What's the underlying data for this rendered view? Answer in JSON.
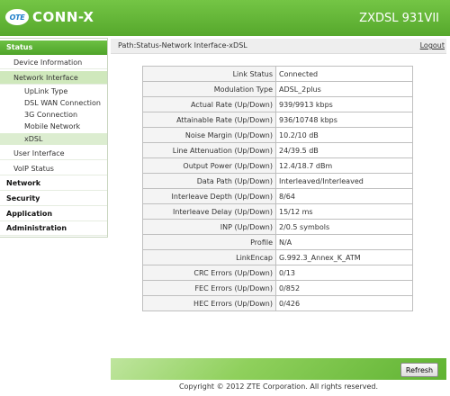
{
  "header": {
    "logo_badge": "OTE",
    "logo_text": "CONN-X",
    "model": "ZXDSL 931VII"
  },
  "sidebar": {
    "status": "Status",
    "device_information": "Device Information",
    "network_interface": "Network Interface",
    "uplink_type": "UpLink Type",
    "dsl_wan_connection": "DSL WAN Connection",
    "3g_connection": "3G Connection",
    "mobile_network": "Mobile Network",
    "xdsl": "xDSL",
    "user_interface": "User Interface",
    "voip_status": "VoIP Status",
    "network": "Network",
    "security": "Security",
    "application": "Application",
    "administration": "Administration"
  },
  "pathbar": {
    "path": "Path:Status-Network Interface-xDSL",
    "logout": "Logout"
  },
  "table": {
    "rows": [
      {
        "label": "Link Status",
        "value": "Connected"
      },
      {
        "label": "Modulation Type",
        "value": "ADSL_2plus"
      },
      {
        "label": "Actual Rate (Up/Down)",
        "value": "939/9913 kbps"
      },
      {
        "label": "Attainable Rate (Up/Down)",
        "value": "936/10748 kbps"
      },
      {
        "label": "Noise Margin (Up/Down)",
        "value": "10.2/10 dB"
      },
      {
        "label": "Line Attenuation (Up/Down)",
        "value": "24/39.5 dB"
      },
      {
        "label": "Output Power (Up/Down)",
        "value": "12.4/18.7 dBm"
      },
      {
        "label": "Data Path (Up/Down)",
        "value": "Interleaved/Interleaved"
      },
      {
        "label": "Interleave Depth (Up/Down)",
        "value": "8/64"
      },
      {
        "label": "Interleave Delay (Up/Down)",
        "value": "15/12 ms"
      },
      {
        "label": "INP (Up/Down)",
        "value": "2/0.5 symbols"
      },
      {
        "label": "Profile",
        "value": "N/A"
      },
      {
        "label": "LinkEncap",
        "value": "G.992.3_Annex_K_ATM"
      },
      {
        "label": "CRC Errors (Up/Down)",
        "value": "0/13"
      },
      {
        "label": "FEC Errors (Up/Down)",
        "value": "0/852"
      },
      {
        "label": "HEC Errors (Up/Down)",
        "value": "0/426"
      }
    ]
  },
  "footer": {
    "refresh": "Refresh",
    "copyright": "Copyright © 2012 ZTE Corporation. All rights reserved."
  }
}
